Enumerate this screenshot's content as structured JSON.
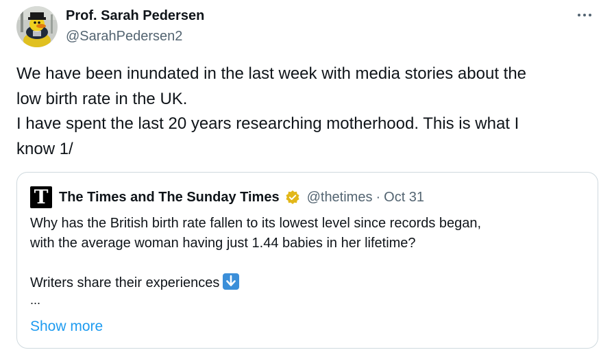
{
  "author": {
    "display_name": "Prof. Sarah Pedersen",
    "handle": "@SarahPedersen2",
    "avatar_icon": "rubber-duck-avatar"
  },
  "more_icon": "more-horizontal-icon",
  "tweet_text": {
    "line1": "We have been inundated in the last week with media stories about the",
    "line2": "low birth rate in the UK.",
    "line3": "I have spent the last 20 years researching motherhood. This is what I",
    "line4": "know 1/"
  },
  "quoted_tweet": {
    "avatar_letter": "T",
    "display_name": "The Times and The Sunday Times",
    "verified_icon": "verified-gold-badge-icon",
    "handle": "@thetimes",
    "separator": "·",
    "date": "Oct 31",
    "text_line1": "Why has the British birth rate fallen to its lowest level since records began,",
    "text_line2": "with the average woman having just 1.44 babies in her lifetime?",
    "text_line3": "Writers share their experiences",
    "arrow_icon": "down-arrow-emoji-icon",
    "ellipsis": "...",
    "show_more_label": "Show more"
  },
  "colors": {
    "text": "#0f1419",
    "secondary": "#536471",
    "link": "#1d9bf0",
    "border": "#cfd9de",
    "verified_gold": "#e2b719"
  }
}
